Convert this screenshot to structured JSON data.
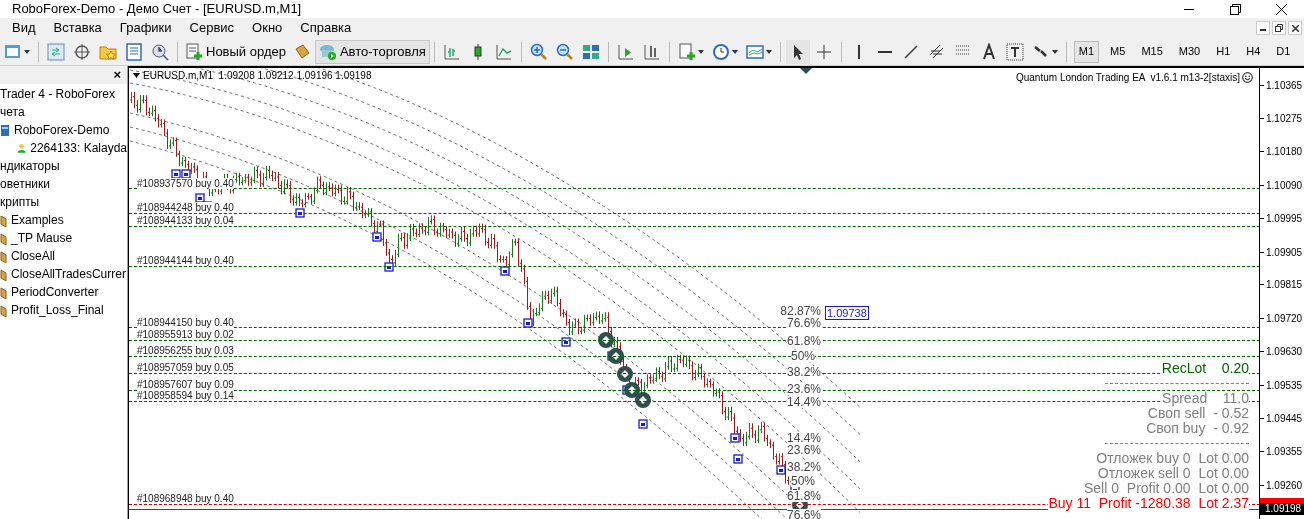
{
  "window": {
    "title": "RoboForex-Demo - Демо Счет - [EURUSD.m,M1]"
  },
  "menu": {
    "items": [
      "Вид",
      "Вставка",
      "Графики",
      "Сервис",
      "Окно",
      "Справка"
    ]
  },
  "toolbar": {
    "new_order": "Новый ордер",
    "auto_trading": "Авто-торговля",
    "timeframes": [
      {
        "label": "M1",
        "selected": true
      },
      {
        "label": "M5",
        "selected": false
      },
      {
        "label": "M15",
        "selected": false
      },
      {
        "label": "M30",
        "selected": false
      },
      {
        "label": "H1",
        "selected": false
      },
      {
        "label": "H4",
        "selected": false
      },
      {
        "label": "D1",
        "selected": false
      }
    ]
  },
  "navigator": {
    "close": "×",
    "tree": [
      {
        "label": "Trader 4 - RoboForex",
        "children": [
          {
            "label": "чета",
            "children": [
              {
                "label": "RoboForex-Demo",
                "kind": "server",
                "children": [
                  {
                    "label": "2264133: Kalayda",
                    "kind": "account"
                  }
                ]
              }
            ]
          },
          {
            "label": "ндикаторы"
          },
          {
            "label": "оветники"
          },
          {
            "label": "крипты",
            "children": [
              {
                "label": "Examples",
                "kind": "script"
              },
              {
                "label": "_TP Mause",
                "kind": "script"
              },
              {
                "label": "CloseAll",
                "kind": "script"
              },
              {
                "label": "CloseAllTradesCurrer",
                "kind": "script"
              },
              {
                "label": "PeriodConverter",
                "kind": "script"
              },
              {
                "label": "Profit_Loss_Final",
                "kind": "script"
              }
            ]
          }
        ]
      }
    ]
  },
  "chart": {
    "header": "EURUSD.m,M1  1.09208 1.09212 1.09196 1.09198",
    "expert": "Quantum London Trading EA  v1.6.1 m13-2[staxis]",
    "orders": [
      {
        "label": "#108937570 buy 0.40",
        "color": "#006400"
      },
      {
        "label": "#108944248 buy 0.40",
        "color": "#006400"
      },
      {
        "label": "#108944133 buy 0.04",
        "color": "#006400"
      },
      {
        "label": "#108944144 buy 0.40",
        "color": "#006400"
      },
      {
        "label": "#108944150 buy 0.40",
        "color": "#006400"
      },
      {
        "label": "#108955913 buy 0.02",
        "color": "#006400"
      },
      {
        "label": "#108956255 buy 0.03",
        "color": "#006400"
      },
      {
        "label": "#108957059 buy 0.05",
        "color": "#006400"
      },
      {
        "label": "#108957607 buy 0.09",
        "color": "#006400"
      },
      {
        "label": "#108958594 buy 0.14",
        "color": "#006400"
      },
      {
        "label": "#108968948 buy 0.40",
        "color": "#cc0000"
      }
    ],
    "fib_labels": [
      "82.87%",
      "76.6%",
      "61.8%",
      "50%",
      "38.2%",
      "23.6%",
      "14.4%",
      "14.4%",
      "23.6%",
      "38.2%",
      "50%",
      "61.8%",
      "76.6%"
    ],
    "price_tag": "1.09738",
    "info": [
      {
        "kind": "text",
        "text": "RecLot    0.20",
        "color": "#006400"
      },
      {
        "kind": "rule"
      },
      {
        "kind": "text",
        "text": "Spread    11.0",
        "color": "#808080"
      },
      {
        "kind": "text",
        "text": "Своп sell  - 0.52",
        "color": "#808080"
      },
      {
        "kind": "text",
        "text": "Своп buy  - 0.92",
        "color": "#808080"
      },
      {
        "kind": "rule"
      },
      {
        "kind": "text",
        "text": "Отложек buy 0  Lot 0.00",
        "color": "#808080"
      },
      {
        "kind": "text",
        "text": "Отложек sell 0  Lot 0.00",
        "color": "#808080"
      },
      {
        "kind": "text",
        "text": "Sell 0  Profit 0.00  Lot 0.00",
        "color": "#808080"
      },
      {
        "kind": "text",
        "text": "Buy 11  Profit -1280.38  Lot 2.37",
        "color": "#ff0000"
      }
    ]
  },
  "price_axis": {
    "labels": [
      "1.10365",
      "1.10275",
      "1.10180",
      "1.10090",
      "1.09995",
      "1.09905",
      "1.09815",
      "1.09720",
      "1.09630",
      "1.09535",
      "1.09445",
      "1.09355",
      "1.09260"
    ],
    "current": "1.09198"
  }
}
